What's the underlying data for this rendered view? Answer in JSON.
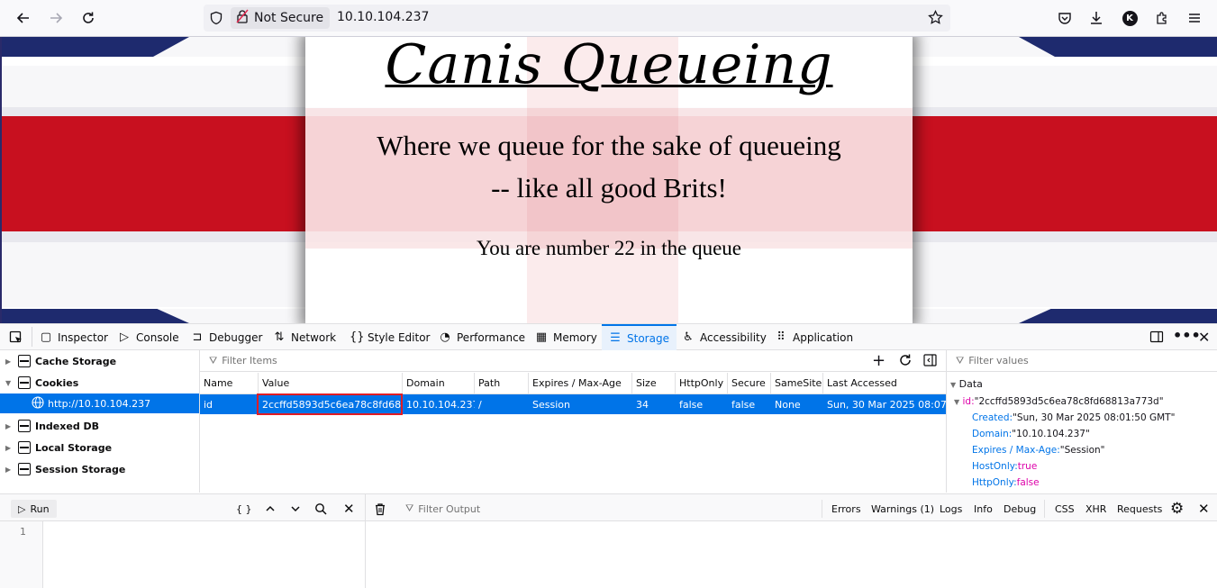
{
  "browser": {
    "security_label": "Not Secure",
    "url": "10.10.104.237",
    "profile_initial": "K"
  },
  "page": {
    "title": "Canis Queueing",
    "tagline_1": "Where we queue for the sake of queueing",
    "tagline_2": "-- like all good Brits!",
    "queue_message": "You are number 22 in the queue"
  },
  "devtools": {
    "tabs": [
      "Inspector",
      "Console",
      "Debugger",
      "Network",
      "Style Editor",
      "Performance",
      "Memory",
      "Storage",
      "Accessibility",
      "Application"
    ],
    "selected_tab": "Storage",
    "tree": {
      "cache_storage": "Cache Storage",
      "cookies": "Cookies",
      "cookie_origin": "http://10.10.104.237",
      "indexed_db": "Indexed DB",
      "local_storage": "Local Storage",
      "session_storage": "Session Storage"
    },
    "table": {
      "filter_placeholder": "Filter Items",
      "headers": [
        "Name",
        "Value",
        "Domain",
        "Path",
        "Expires / Max-Age",
        "Size",
        "HttpOnly",
        "Secure",
        "SameSite",
        "Last Accessed"
      ],
      "row": [
        "id",
        "2ccffd5893d5c6ea78c8fd68…",
        "10.10.104.237",
        "/",
        "Session",
        "34",
        "false",
        "false",
        "None",
        "Sun, 30 Mar 2025 08:07…"
      ]
    },
    "data_panel": {
      "filter_placeholder": "Filter values",
      "heading": "Data",
      "id_key": "id:",
      "id_value": "\"2ccffd5893d5c6ea78c8fd68813a773d\"",
      "created_key": "Created:",
      "created_value": "\"Sun, 30 Mar 2025 08:01:50 GMT\"",
      "domain_key": "Domain:",
      "domain_value": "\"10.10.104.237\"",
      "expires_key": "Expires / Max-Age:",
      "expires_value": "\"Session\"",
      "hostonly_key": "HostOnly:",
      "hostonly_value": "true",
      "httponly_key": "HttpOnly:",
      "httponly_value": "false"
    },
    "console": {
      "run_label": "Run",
      "braces": "{ }",
      "filter_placeholder": "Filter Output",
      "filters": [
        "Errors",
        "Warnings (1)",
        "Logs",
        "Info",
        "Debug",
        "CSS",
        "XHR",
        "Requests"
      ],
      "line_number": "1"
    }
  }
}
